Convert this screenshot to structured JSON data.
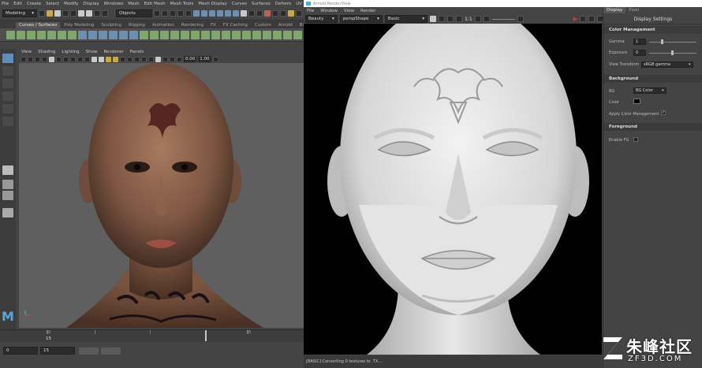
{
  "maya": {
    "menu": [
      "File",
      "Edit",
      "Create",
      "Select",
      "Modify",
      "Display",
      "Windows",
      "Mesh",
      "Edit Mesh",
      "Mesh Tools",
      "Mesh Display",
      "Curves",
      "Surfaces",
      "Deform",
      "UV",
      "Ge"
    ],
    "menu_set": "Modeling",
    "objects_field": "Objects",
    "shelf_tabs": [
      "Curves / Surfaces",
      "Poly Modeling",
      "Sculpting",
      "Rigging",
      "Animation",
      "Rendering",
      "FX",
      "FX Caching",
      "Custom",
      "Arnold",
      "Bifr"
    ],
    "active_shelf_tab": "Curves / Surfaces",
    "panel_menu": [
      "View",
      "Shading",
      "Lighting",
      "Show",
      "Renderer",
      "Panels"
    ],
    "panel_fields": {
      "near": "0.00",
      "far": "1.00"
    },
    "time_ticks": [
      "10",
      "15"
    ],
    "current_frame": "15",
    "range_start": "0",
    "range_end": "15",
    "logo": "M"
  },
  "render_view": {
    "title": "Arnold RenderView",
    "menu": [
      "File",
      "Window",
      "View",
      "Render"
    ],
    "aov": "Beauty",
    "camera": "perspShape",
    "mode": "Basic",
    "zoom": "1:1",
    "status": "[BASIC] Converting 0 textures to .TX..."
  },
  "display_settings": {
    "tabs": [
      "Display",
      "Pixel"
    ],
    "active_tab": "Display",
    "title": "Display Settings",
    "color_management": {
      "section": "Color Management",
      "gamma_label": "Gamma",
      "gamma_value": "1",
      "exposure_label": "Exposure",
      "exposure_value": "0",
      "view_transform_label": "View Transform",
      "view_transform_value": "sRGB gamma"
    },
    "background": {
      "section": "Background",
      "bg_label": "BG",
      "bg_value": "BG Color",
      "color_label": "Color",
      "apply_cm_label": "Apply Color Management",
      "apply_cm_checked": true
    },
    "foreground": {
      "section": "Foreground",
      "enable_fg_label": "Enable FG",
      "enable_fg_checked": false
    }
  },
  "watermark": {
    "cn": "朱峰社区",
    "en": "ZF3D.COM"
  }
}
